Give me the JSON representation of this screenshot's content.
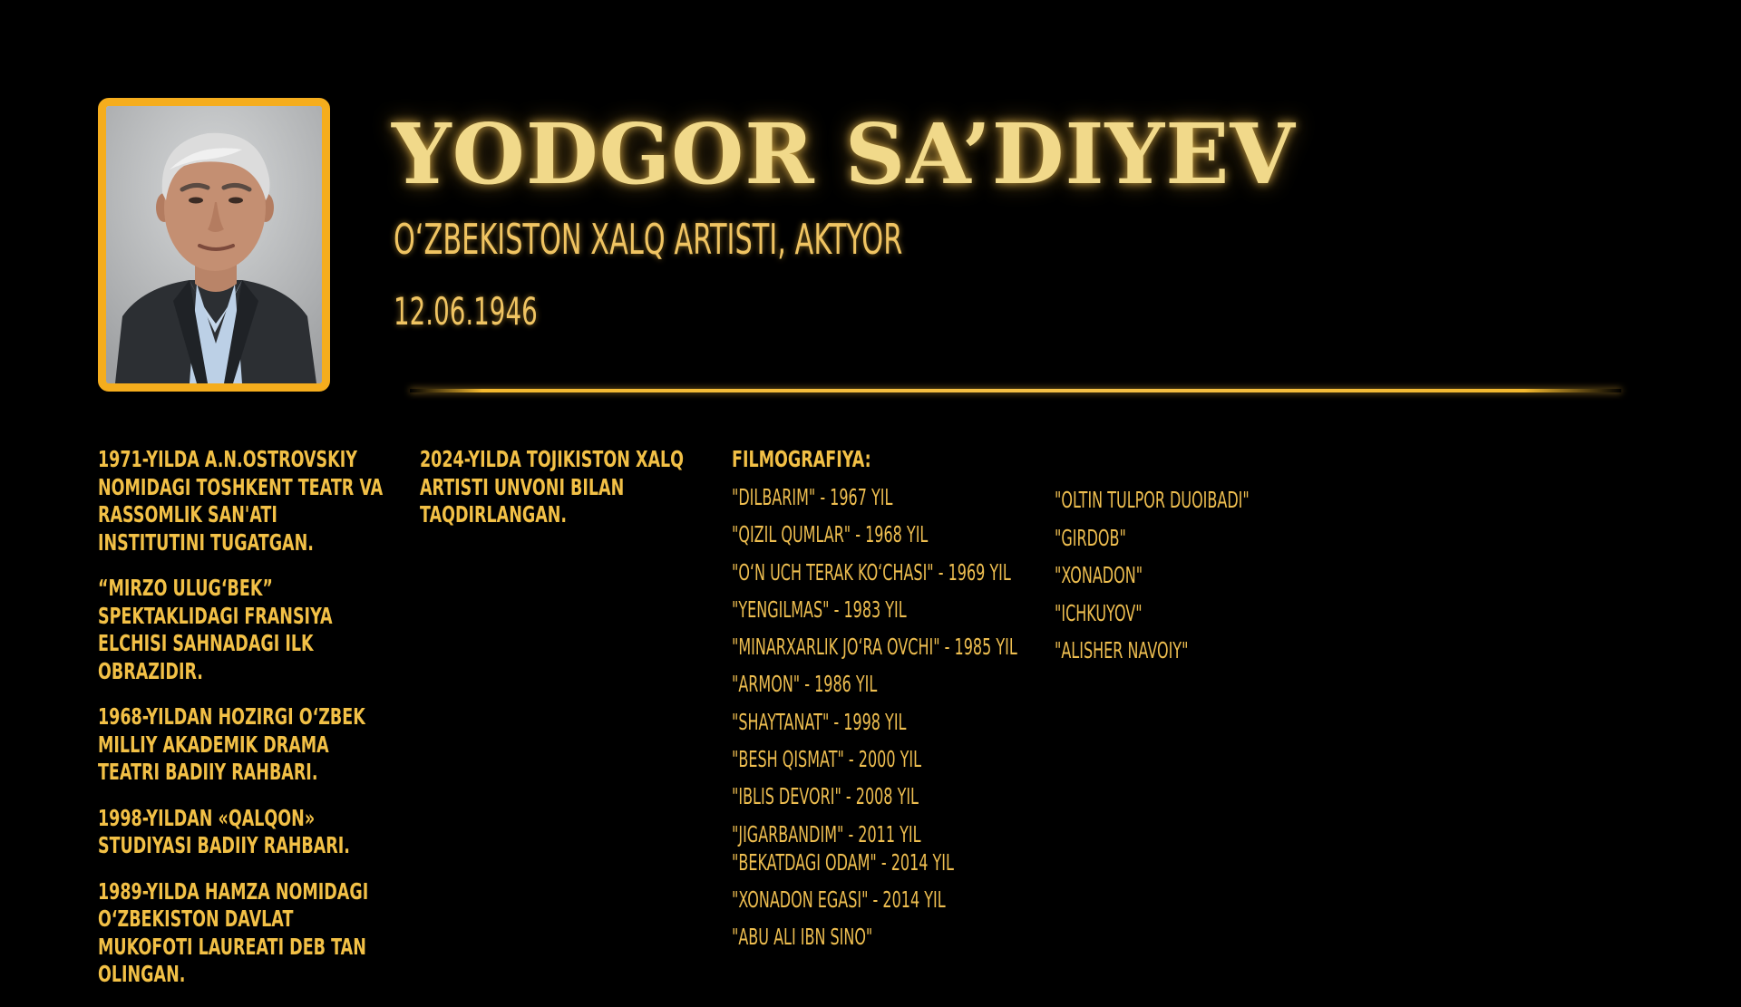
{
  "header": {
    "name": "YODGOR SA’DIYEV",
    "subtitle": "O‘ZBEKISTON XALQ ARTISTI, AKTYOR",
    "birthdate": "12.06.1946"
  },
  "colors": {
    "background": "#000000",
    "accent_gold": "#F5AD1D",
    "title_text": "#F1D98A",
    "body_text": "#F2C046"
  },
  "biography": {
    "column1": [
      "1971-yilda A.N.Ostrovskiy nomidagi Toshkent teatr va rassomlik san'ati institutini tugatgan.",
      "“Mirzo Ulug‘bek” spektaklidagi Fransiya elchisi sahnadagi ilk obrazidir.",
      "1968-yildan hozirgi O‘zbek Milliy Akademik drama teatri badiiy rahbari.",
      "1998-yildan «Qalqon» studiyasi badiiy rahbari.",
      "1989-yilda Hamza nomidagi O‘zbekiston Davlat mukofoti laureati deb tan olingan."
    ],
    "column2": [
      "2024-yilda Tojikiston xalq artisti unvoni bilan taqdirlangan."
    ]
  },
  "filmography": {
    "heading": "FILMOGRAFIYA:",
    "column1": [
      "\"Dilbarim\" - 1967 yil",
      "\"Qizil qumlar\" - 1968 yil",
      "\"O‘n uch terak ko‘chasi\" - 1969 yil",
      "\"Yengilmas\" - 1983 yil",
      "\"Minarxarlik Jo‘ra ovchi\" - 1985 yil",
      "\"Armon\" - 1986 yil",
      "\"Shaytanat\" - 1998 yil",
      "\"Besh qismat\" - 2000 yil",
      "\"Iblis devori\" - 2008 yil",
      "\"Jigarbandim\" - 2011 yil",
      "\"Bekatdagi odam\" - 2014 yil",
      "\"Xonadon egasi\" - 2014 yil",
      "\"Abu Ali ibn Sino\""
    ],
    "column2": [
      "\"Oltin tulpor duoibadi\"",
      "\"Girdob\"",
      "\"Xonadon\"",
      "\"Ichkuyov\"",
      "\"Alisher Navoiy\""
    ]
  }
}
